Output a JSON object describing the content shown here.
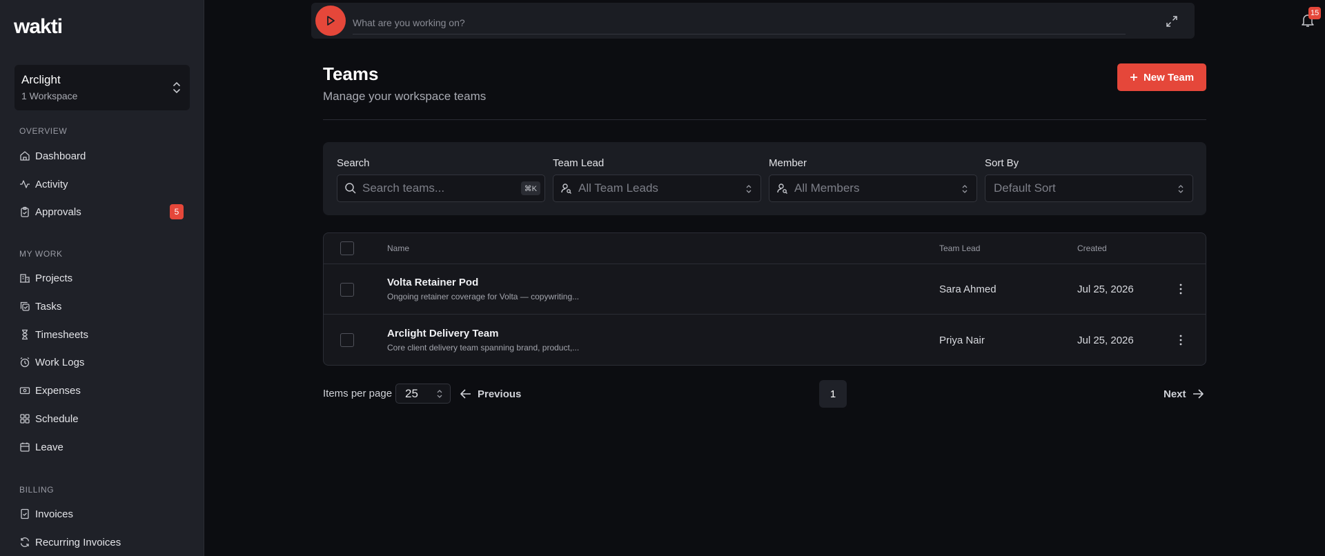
{
  "brand": {
    "logo_text": "wakti"
  },
  "workspace": {
    "name": "Arclight",
    "subtitle": "1 Workspace"
  },
  "sidebar": {
    "sections": [
      {
        "label": "OVERVIEW",
        "items": [
          {
            "label": "Dashboard",
            "icon": "home-icon"
          },
          {
            "label": "Activity",
            "icon": "activity-icon"
          },
          {
            "label": "Approvals",
            "icon": "clipboard-check-icon",
            "badge": "5"
          }
        ]
      },
      {
        "label": "MY WORK",
        "items": [
          {
            "label": "Projects",
            "icon": "building-icon"
          },
          {
            "label": "Tasks",
            "icon": "copy-check-icon"
          },
          {
            "label": "Timesheets",
            "icon": "hourglass-icon"
          },
          {
            "label": "Work Logs",
            "icon": "alarm-clock-icon"
          },
          {
            "label": "Expenses",
            "icon": "banknote-icon"
          },
          {
            "label": "Schedule",
            "icon": "grid-icon"
          },
          {
            "label": "Leave",
            "icon": "calendar-icon"
          }
        ]
      },
      {
        "label": "BILLING",
        "items": [
          {
            "label": "Invoices",
            "icon": "file-check-icon"
          },
          {
            "label": "Recurring Invoices",
            "icon": "refresh-icon"
          }
        ]
      }
    ]
  },
  "timer": {
    "placeholder": "What are you working on?"
  },
  "notifications": {
    "count": "15"
  },
  "header": {
    "title": "Teams",
    "subtitle": "Manage your workspace teams",
    "new_button": "New Team"
  },
  "filters": {
    "search": {
      "label": "Search",
      "placeholder": "Search teams...",
      "shortcut": "⌘K"
    },
    "team_lead": {
      "label": "Team Lead",
      "value": "All Team Leads"
    },
    "member": {
      "label": "Member",
      "value": "All Members"
    },
    "sort": {
      "label": "Sort By",
      "value": "Default Sort"
    }
  },
  "table": {
    "columns": {
      "name": "Name",
      "lead": "Team Lead",
      "created": "Created"
    },
    "rows": [
      {
        "name": "Volta Retainer Pod",
        "description": "Ongoing retainer coverage for Volta — copywriting...",
        "lead": "Sara Ahmed",
        "created": "Jul 25, 2026"
      },
      {
        "name": "Arclight Delivery Team",
        "description": "Core client delivery team spanning brand, product,...",
        "lead": "Priya Nair",
        "created": "Jul 25, 2026"
      }
    ]
  },
  "pagination": {
    "items_per_page_label": "Items per page",
    "items_per_page": "25",
    "previous": "Previous",
    "next": "Next",
    "current_page": "1"
  },
  "colors": {
    "accent": "#e5473a",
    "sidebar_bg": "#1f2128",
    "page_bg": "#0c0d11"
  }
}
